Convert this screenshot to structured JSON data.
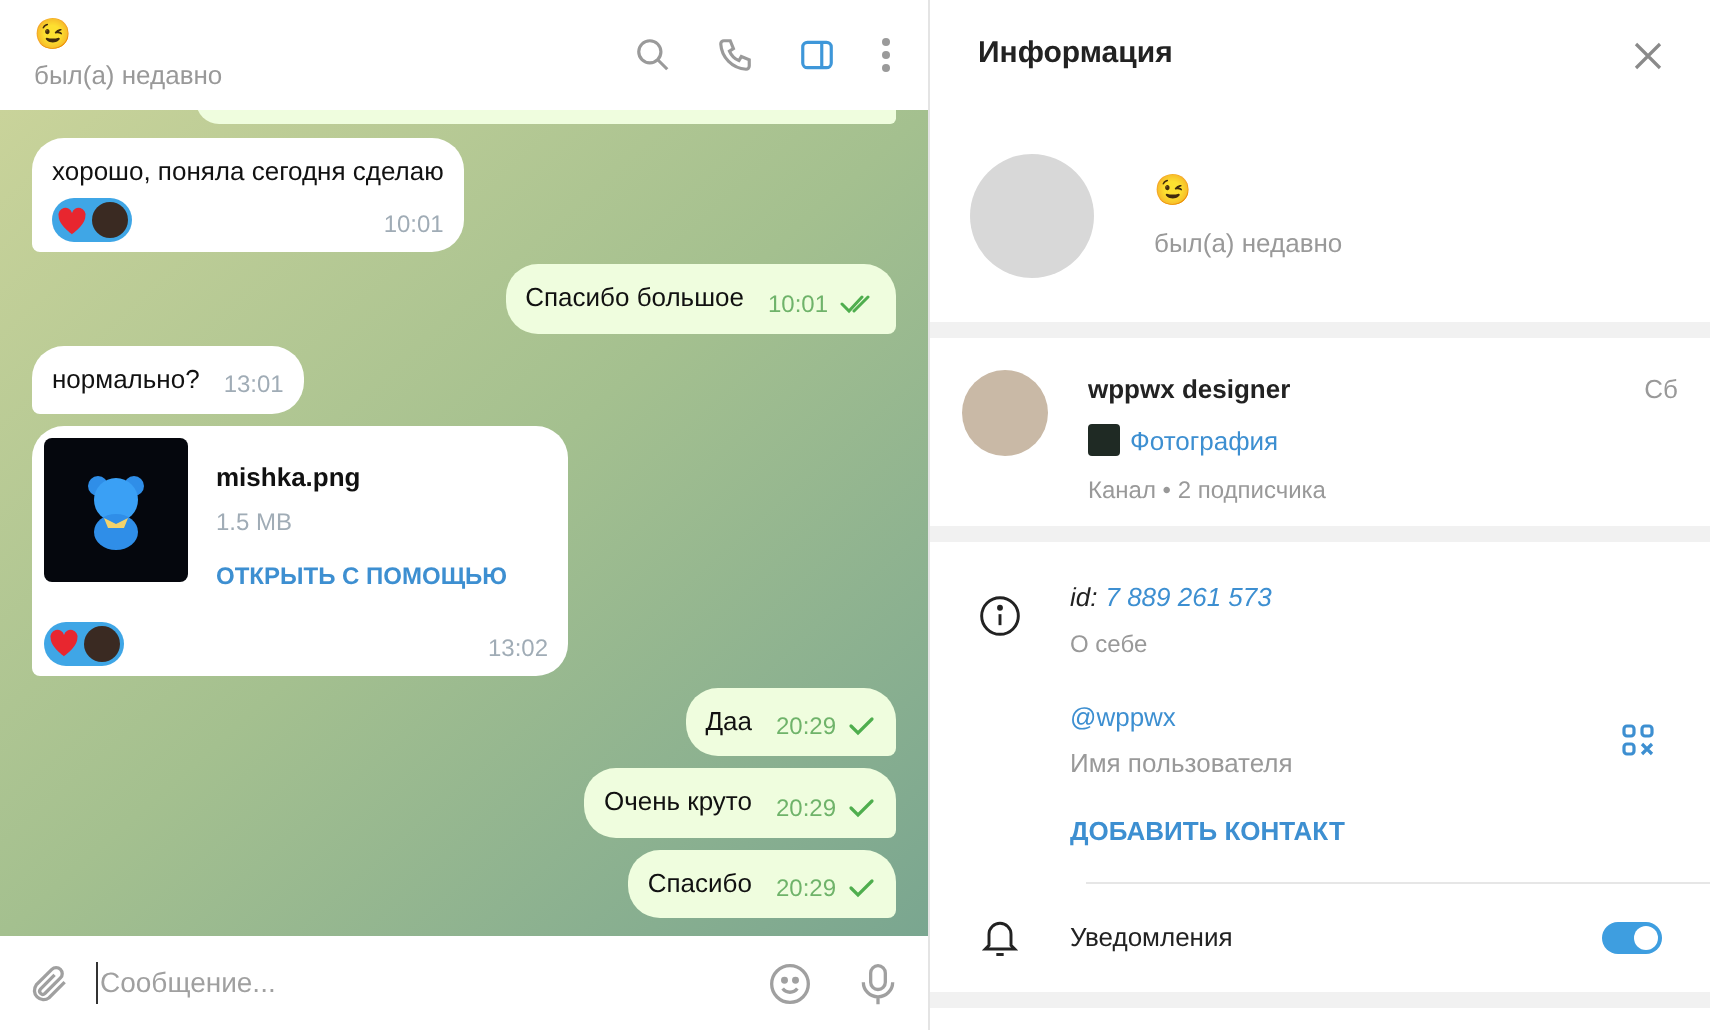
{
  "chat_header": {
    "name": "😉",
    "status": "был(а) недавно",
    "side_panel_open": true
  },
  "messages": [
    {
      "kind": "partial",
      "outgoing": true
    },
    {
      "kind": "text",
      "outgoing": false,
      "text": "хорошо, поняла сегодня сделаю",
      "time": "10:01",
      "reacted": true
    },
    {
      "kind": "text",
      "outgoing": true,
      "text": "Спасибо большое",
      "time": "10:01",
      "read": true
    },
    {
      "kind": "text",
      "outgoing": false,
      "text": "нормально?",
      "time": "13:01",
      "reacted": false
    },
    {
      "kind": "file",
      "outgoing": false,
      "file_name": "mishka.png",
      "size": "1.5 MB",
      "action": "ОТКРЫТЬ С ПОМОЩЬЮ",
      "time": "13:02",
      "reacted": true
    },
    {
      "kind": "text",
      "outgoing": true,
      "text": "Даа",
      "time": "20:29",
      "read": false
    },
    {
      "kind": "text",
      "outgoing": true,
      "text": "Очень круто",
      "time": "20:29",
      "read": false
    },
    {
      "kind": "text",
      "outgoing": true,
      "text": "Спасибо",
      "time": "20:29",
      "read": false
    }
  ],
  "composer": {
    "placeholder": "Сообщение..."
  },
  "info_panel": {
    "title": "Информация",
    "name": "😉",
    "status": "был(а) недавно",
    "channel": {
      "name": "wppwx designer",
      "date": "Сб",
      "preview": "Фотография",
      "meta": "Канал • 2 подписчика"
    },
    "id_label": "id:",
    "id_value": "7 889 261 573",
    "bio_label": "О себе",
    "username": "@wppwx",
    "username_label": "Имя пользователя",
    "add_contact": "ДОБАВИТЬ КОНТАКТ",
    "notifications": {
      "label": "Уведомления",
      "on": true
    }
  }
}
